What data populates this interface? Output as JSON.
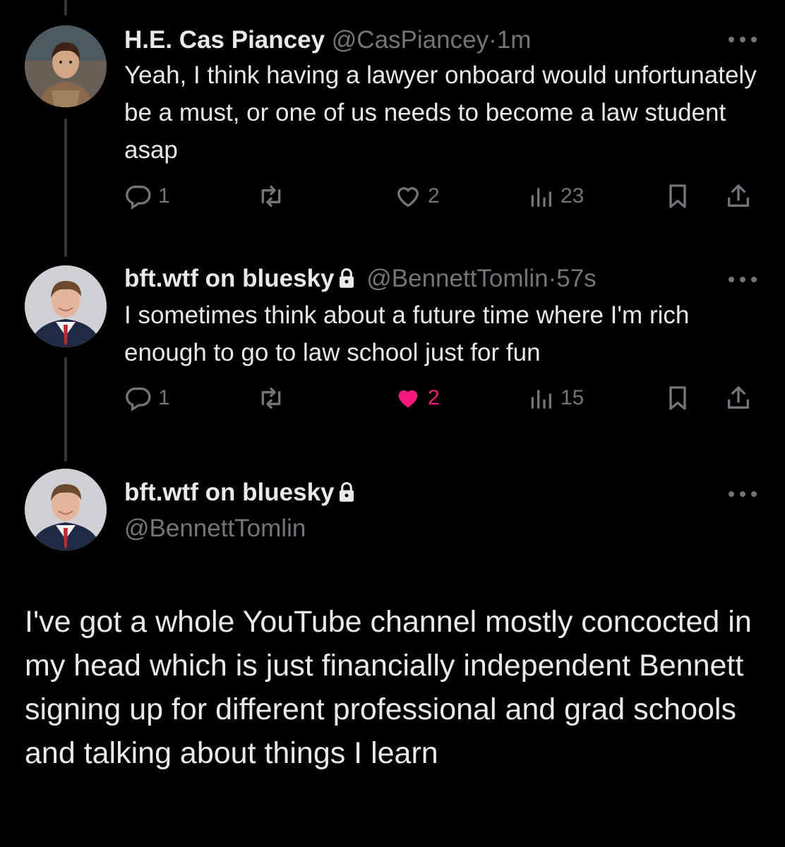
{
  "tweets": [
    {
      "name": "H.E. Cas Piancey",
      "handle": "@CasPiancey",
      "separator": "·",
      "time": "1m",
      "text": "Yeah, I think having a lawyer onboard would unfortunately be a must, or one of us needs to become a law student asap",
      "replies": "1",
      "likes": "2",
      "liked": false,
      "views": "23"
    },
    {
      "name": "bft.wtf on bluesky",
      "handle": "@BennettTomlin",
      "separator": "·",
      "time": "57s",
      "protected": true,
      "text": "I sometimes think about a future time where I'm rich enough to go to law school just for fun",
      "replies": "1",
      "likes": "2",
      "liked": true,
      "views": "15"
    }
  ],
  "main_tweet": {
    "name": "bft.wtf on bluesky",
    "handle": "@BennettTomlin",
    "protected": true,
    "text": "I've got a whole YouTube channel mostly concocted in my head which is just financially independent Bennett signing up for different professional and grad schools and talking about things I learn"
  },
  "colors": {
    "background": "#000000",
    "text": "#e7e9ea",
    "muted": "#71767b",
    "like": "#f91880",
    "thread_line": "#333639"
  },
  "icons": [
    "reply-icon",
    "retweet-icon",
    "heart-icon",
    "views-icon",
    "bookmark-icon",
    "share-icon",
    "lock-icon",
    "more-icon"
  ]
}
